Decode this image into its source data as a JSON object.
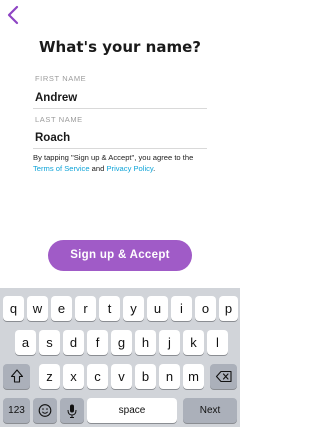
{
  "header": {
    "back_icon": "chevron-left-icon",
    "title": "What's your name?"
  },
  "first_name": {
    "label": "FIRST NAME",
    "value": "Andrew"
  },
  "last_name": {
    "label": "LAST NAME",
    "value": "Roach"
  },
  "legal": {
    "prefix": "By tapping \"Sign up & Accept\", you agree to the",
    "terms_link": "Terms of Service",
    "conjunction": "and",
    "privacy_link": "Privacy Policy",
    "suffix": "."
  },
  "signup_button": {
    "label": "Sign up & Accept"
  },
  "keyboard": {
    "row1": [
      "q",
      "w",
      "e",
      "r",
      "t",
      "y",
      "u",
      "i",
      "o",
      "p"
    ],
    "row2": [
      "a",
      "s",
      "d",
      "f",
      "g",
      "h",
      "j",
      "k",
      "l"
    ],
    "row3": [
      "z",
      "x",
      "c",
      "v",
      "b",
      "n",
      "m"
    ],
    "numbers_key": "123",
    "space_key": "space",
    "next_key": "Next",
    "shift_icon": "shift-icon",
    "backspace_icon": "backspace-icon",
    "emoji_icon": "emoji-icon",
    "mic_icon": "microphone-icon"
  },
  "colors": {
    "accent": "#a05bc7",
    "link": "#0fa4d8",
    "keyboard_bg": "#d1d4d9"
  }
}
